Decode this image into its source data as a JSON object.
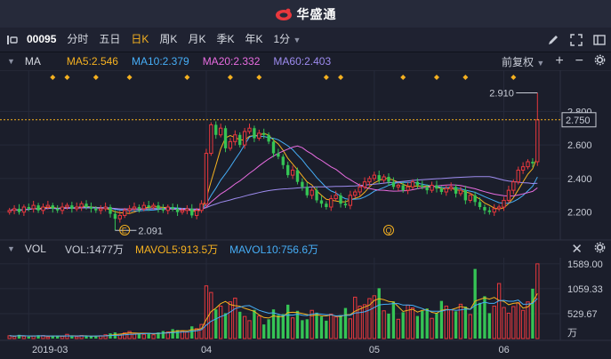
{
  "brand": {
    "name": "华盛通"
  },
  "toolbar": {
    "code": "00095",
    "periods": [
      "分时",
      "五日",
      "日K",
      "周K",
      "月K",
      "季K",
      "年K"
    ],
    "active": "日K",
    "interval": "1分"
  },
  "pane1": {
    "indicator": "MA",
    "ma": [
      {
        "label": "MA5:2.546",
        "color": "#f5b120"
      },
      {
        "label": "MA10:2.379",
        "color": "#46aef7"
      },
      {
        "label": "MA20:2.332",
        "color": "#e86ce0"
      },
      {
        "label": "MA60:2.403",
        "color": "#9e8cf0"
      }
    ],
    "adjust": "前复权"
  },
  "pane2": {
    "indicator": "VOL",
    "items": [
      {
        "label": "VOL:1477万",
        "color": "#c8ccd6"
      },
      {
        "label": "MAVOL5:913.5万",
        "color": "#f5b120"
      },
      {
        "label": "MAVOL10:756.6万",
        "color": "#46aef7"
      }
    ]
  },
  "colors": {
    "up": "#e8383d",
    "down": "#35c455",
    "background": "#1b1e2b"
  },
  "chart_data": {
    "type": "candlestick",
    "price_axis": {
      "ticks": [
        "2.800",
        "2.600",
        "2.400",
        "2.200"
      ],
      "current": "2.750",
      "ylim": [
        2.05,
        2.95
      ]
    },
    "volume_axis": {
      "ticks": [
        "1589.00",
        "1059.33",
        "529.67"
      ],
      "unit": "万",
      "ylim": [
        0,
        1700
      ]
    },
    "x_labels": [
      "2019-03",
      "04",
      "05",
      "06"
    ],
    "annotations": {
      "high": "2.910",
      "low": "2.091",
      "markers": [
        "E",
        "Q"
      ]
    },
    "close": [
      2.21,
      2.22,
      2.2,
      2.23,
      2.22,
      2.24,
      2.21,
      2.23,
      2.24,
      2.22,
      2.21,
      2.23,
      2.24,
      2.22,
      2.23,
      2.25,
      2.23,
      2.22,
      2.21,
      2.22,
      2.23,
      2.19,
      2.16,
      2.18,
      2.21,
      2.22,
      2.23,
      2.22,
      2.24,
      2.23,
      2.24,
      2.22,
      2.21,
      2.23,
      2.22,
      2.2,
      2.21,
      2.22,
      2.18,
      2.21,
      2.25,
      2.55,
      2.72,
      2.66,
      2.7,
      2.58,
      2.62,
      2.66,
      2.6,
      2.68,
      2.7,
      2.64,
      2.67,
      2.66,
      2.62,
      2.55,
      2.53,
      2.48,
      2.42,
      2.45,
      2.38,
      2.35,
      2.3,
      2.33,
      2.27,
      2.25,
      2.23,
      2.28,
      2.3,
      2.25,
      2.24,
      2.3,
      2.32,
      2.35,
      2.38,
      2.4,
      2.42,
      2.39,
      2.41,
      2.38,
      2.35,
      2.36,
      2.33,
      2.35,
      2.38,
      2.36,
      2.35,
      2.33,
      2.36,
      2.34,
      2.32,
      2.34,
      2.35,
      2.31,
      2.33,
      2.27,
      2.3,
      2.26,
      2.23,
      2.21,
      2.2,
      2.22,
      2.23,
      2.27,
      2.33,
      2.38,
      2.45,
      2.47,
      2.5,
      2.49,
      2.75
    ],
    "volume": [
      60,
      45,
      80,
      50,
      40,
      55,
      70,
      65,
      35,
      45,
      60,
      50,
      90,
      45,
      40,
      65,
      55,
      50,
      45,
      60,
      80,
      110,
      130,
      90,
      120,
      150,
      100,
      110,
      90,
      120,
      80,
      130,
      160,
      140,
      200,
      180,
      160,
      140,
      260,
      210,
      300,
      1120,
      980,
      620,
      690,
      540,
      780,
      860,
      570,
      470,
      380,
      610,
      480,
      300,
      410,
      620,
      500,
      520,
      720,
      440,
      590,
      390,
      410,
      600,
      550,
      470,
      380,
      520,
      460,
      500,
      650,
      420,
      880,
      690,
      720,
      850,
      910,
      1070,
      590,
      530,
      790,
      410,
      560,
      710,
      650,
      480,
      590,
      640,
      430,
      540,
      800,
      690,
      610,
      580,
      730,
      680,
      510,
      1480,
      760,
      900,
      540,
      690,
      1170,
      660,
      540,
      680,
      760,
      600,
      780,
      1060,
      1589
    ]
  }
}
